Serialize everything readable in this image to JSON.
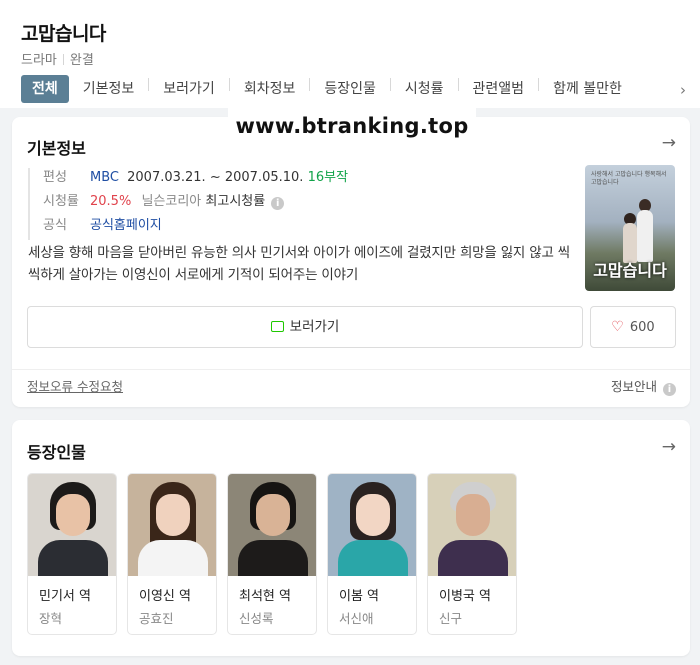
{
  "show": {
    "title": "고맙습니다",
    "genre": "드라마",
    "status": "완결"
  },
  "tabs": [
    "전체",
    "기본정보",
    "보러가기",
    "회차정보",
    "등장인물",
    "시청률",
    "관련앨범",
    "함께 볼만한"
  ],
  "watermark": "www.btranking.top",
  "basic_info": {
    "title": "기본정보",
    "broadcast_label": "편성",
    "broadcaster": "MBC",
    "dates": "2007.03.21. ~ 2007.05.10.",
    "episodes": "16부작",
    "rating_label": "시청률",
    "rating": "20.5%",
    "rating_source": "닐슨코리아",
    "rating_note": "최고시청률",
    "official_label": "공식",
    "official_link": "공식홈페이지",
    "synopsis": "세상을 향해 마음을 닫아버린 유능한 의사 민기서와 아이가 에이즈에 걸렸지만 희망을 잃지 않고 씩씩하게 살아가는 이영신이 서로에게 기적이 되어주는 이야기",
    "poster_title": "고맙습니다",
    "poster_tagline": "사랑해서 고맙습니다 행복해서 고맙습니다",
    "watch_label": "보러가기",
    "like_count": "600",
    "report_label": "정보오류 수정요청",
    "guide_label": "정보안내"
  },
  "cast_section": {
    "title": "등장인물",
    "members": [
      {
        "role": "민기서 역",
        "actor": "장혁"
      },
      {
        "role": "이영신 역",
        "actor": "공효진"
      },
      {
        "role": "최석현 역",
        "actor": "신성록"
      },
      {
        "role": "이봄 역",
        "actor": "서신애"
      },
      {
        "role": "이병국 역",
        "actor": "신구"
      }
    ]
  },
  "colors": {
    "active_tab": "#5b7f95",
    "link_blue": "#1f4ea3",
    "rating_red": "#e0434c",
    "episodes_green": "#12a34a"
  }
}
